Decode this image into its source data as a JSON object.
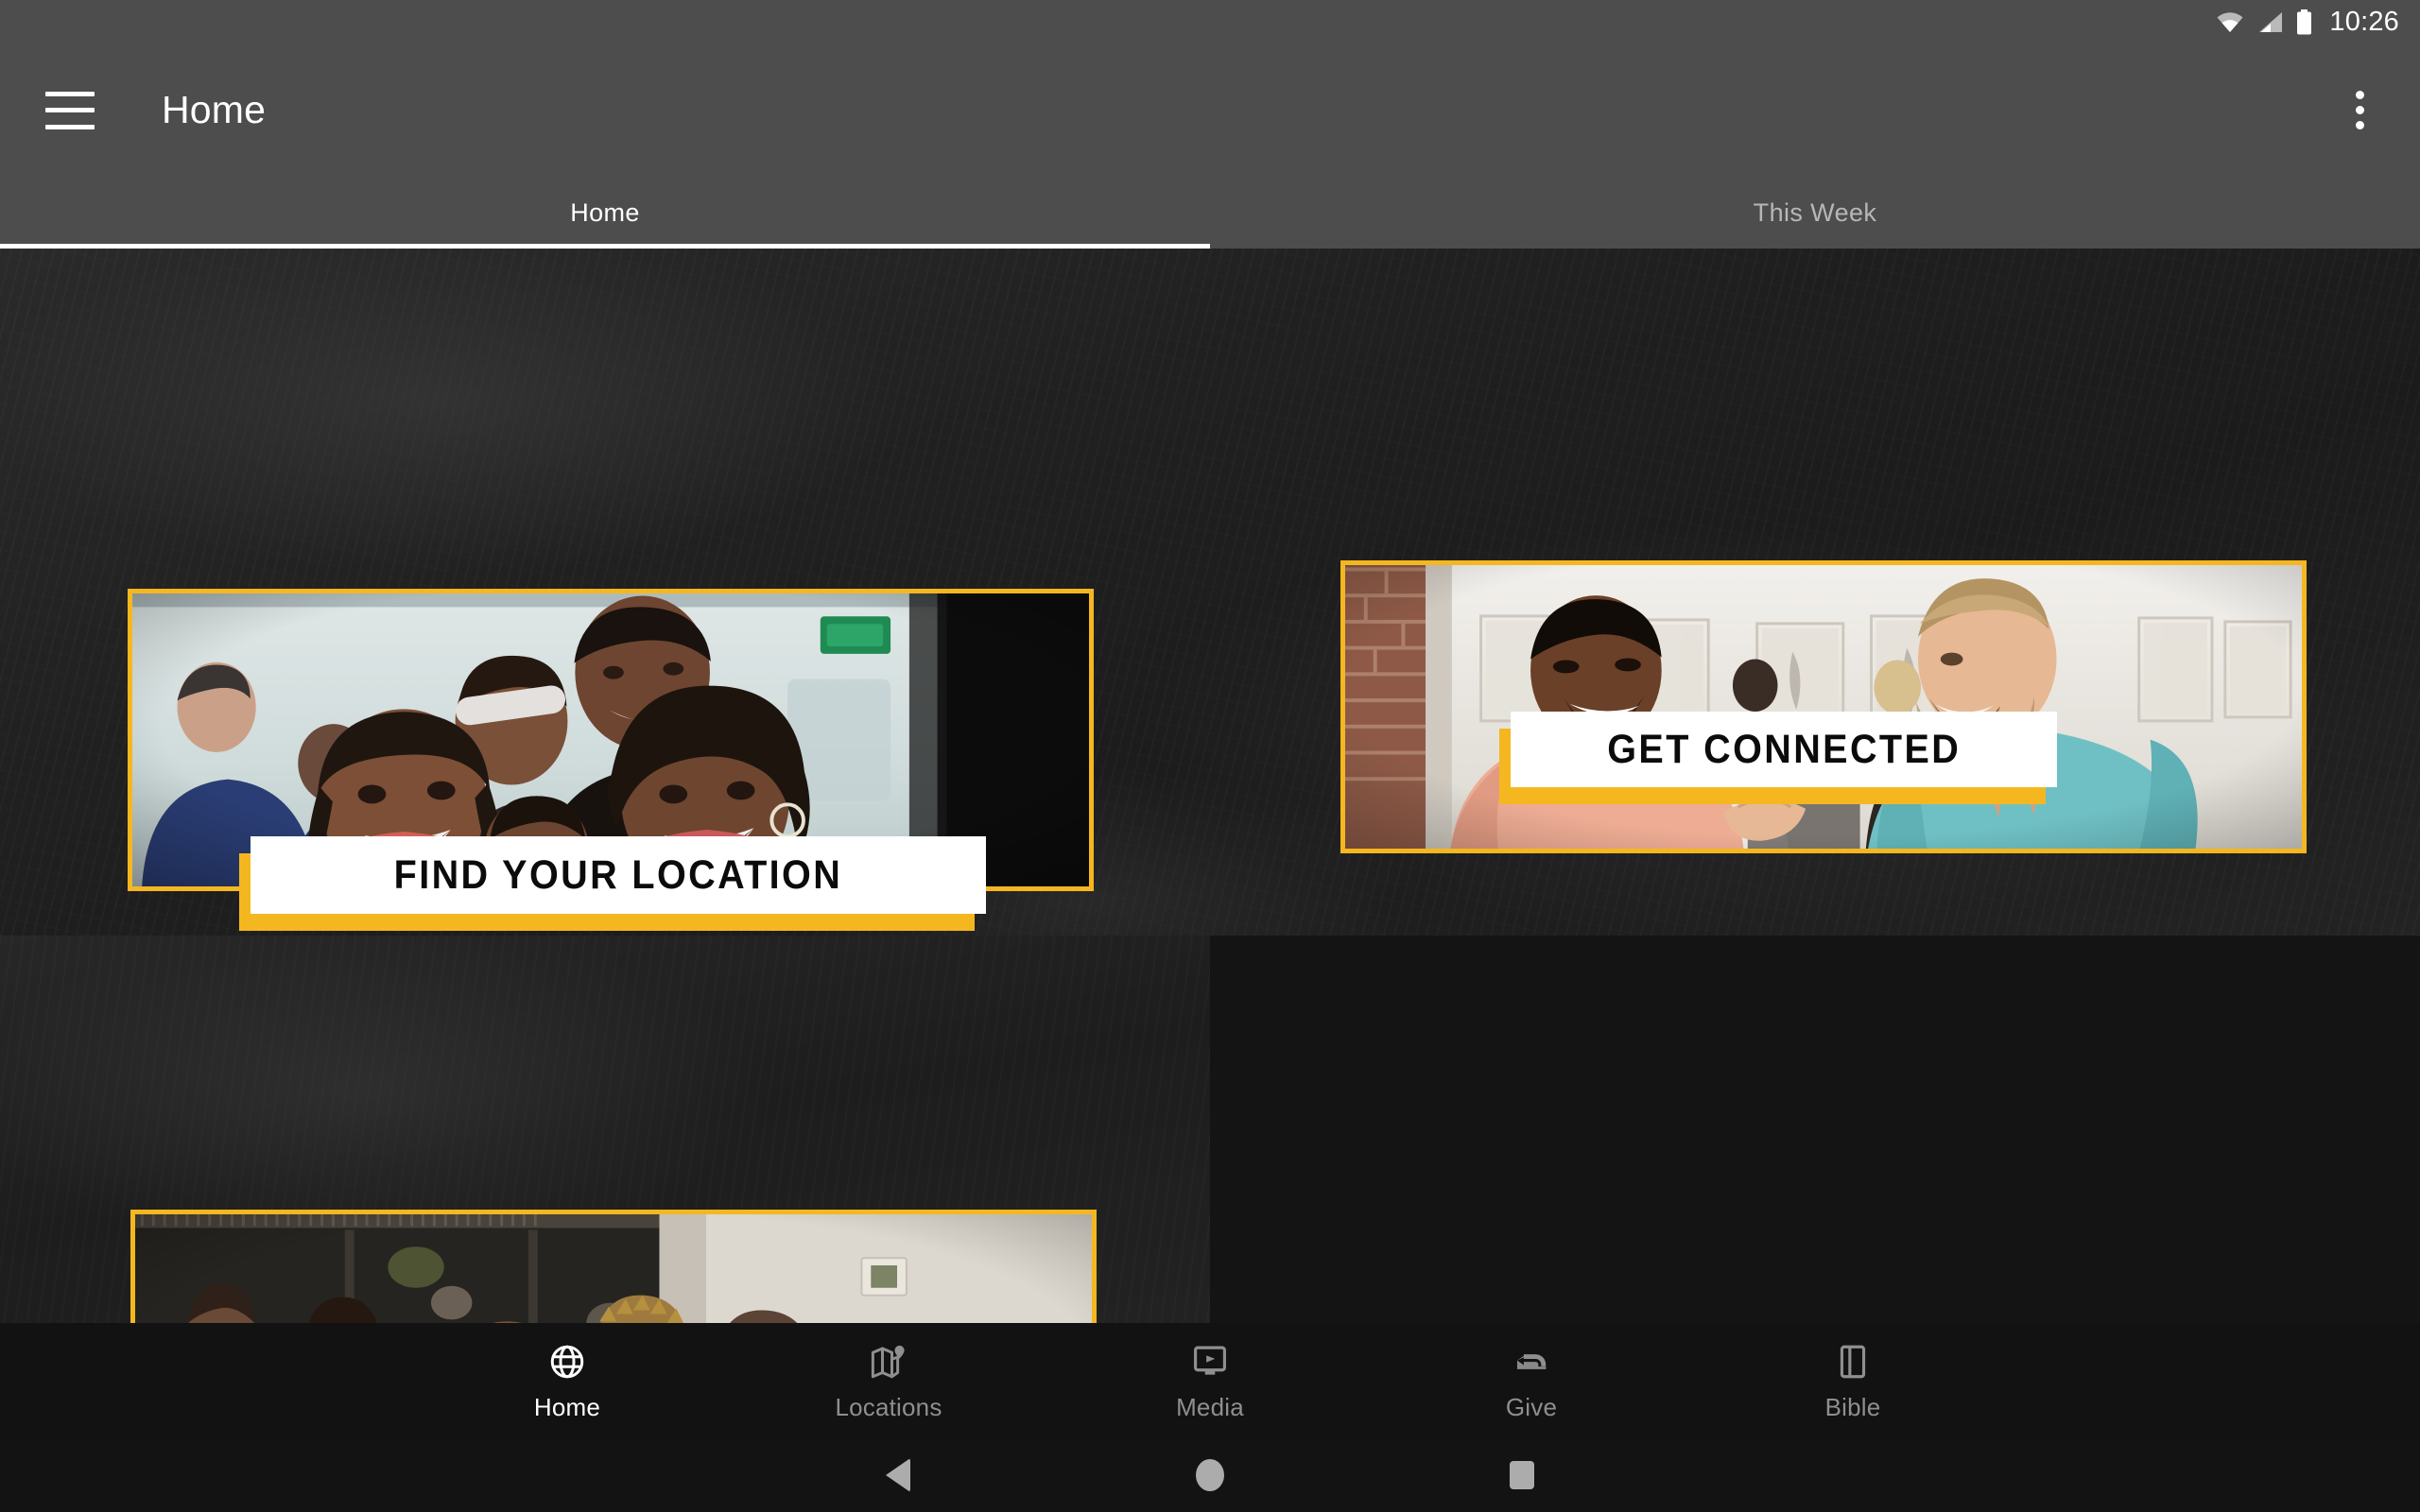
{
  "status_bar": {
    "time": "10:26",
    "icons": [
      "wifi-icon",
      "cellular-signal-icon",
      "battery-icon"
    ]
  },
  "app_bar": {
    "menu_icon": "hamburger-menu-icon",
    "title": "Home",
    "overflow_icon": "overflow-menu-icon"
  },
  "tabs": [
    {
      "label": "Home",
      "active": true
    },
    {
      "label": "This Week",
      "active": false
    }
  ],
  "cards": [
    {
      "id": "locations",
      "label": "FIND YOUR LOCATION",
      "photo_alt": "Smiling family group at a church gathering"
    },
    {
      "id": "connected",
      "label": "GET CONNECTED",
      "photo_alt": "Two men laughing together in a gallery room"
    },
    {
      "id": "events",
      "label": "",
      "photo_alt": "Seated audience of smiling adults at an event"
    }
  ],
  "bottom_nav": [
    {
      "label": "Home",
      "icon": "globe-icon",
      "active": true
    },
    {
      "label": "Locations",
      "icon": "map-pin-icon",
      "active": false
    },
    {
      "label": "Media",
      "icon": "video-player-icon",
      "active": false
    },
    {
      "label": "Give",
      "icon": "open-hand-icon",
      "active": false
    },
    {
      "label": "Bible",
      "icon": "book-icon",
      "active": false
    }
  ],
  "system_bar": {
    "back": "back-button",
    "home": "home-button",
    "recents": "recents-button"
  },
  "colors": {
    "accent_gold": "#f5b720",
    "app_bar": "#4d4d4d",
    "background": "#141414",
    "nav_inactive": "#8f8f8f",
    "nav_active": "#ffffff"
  }
}
